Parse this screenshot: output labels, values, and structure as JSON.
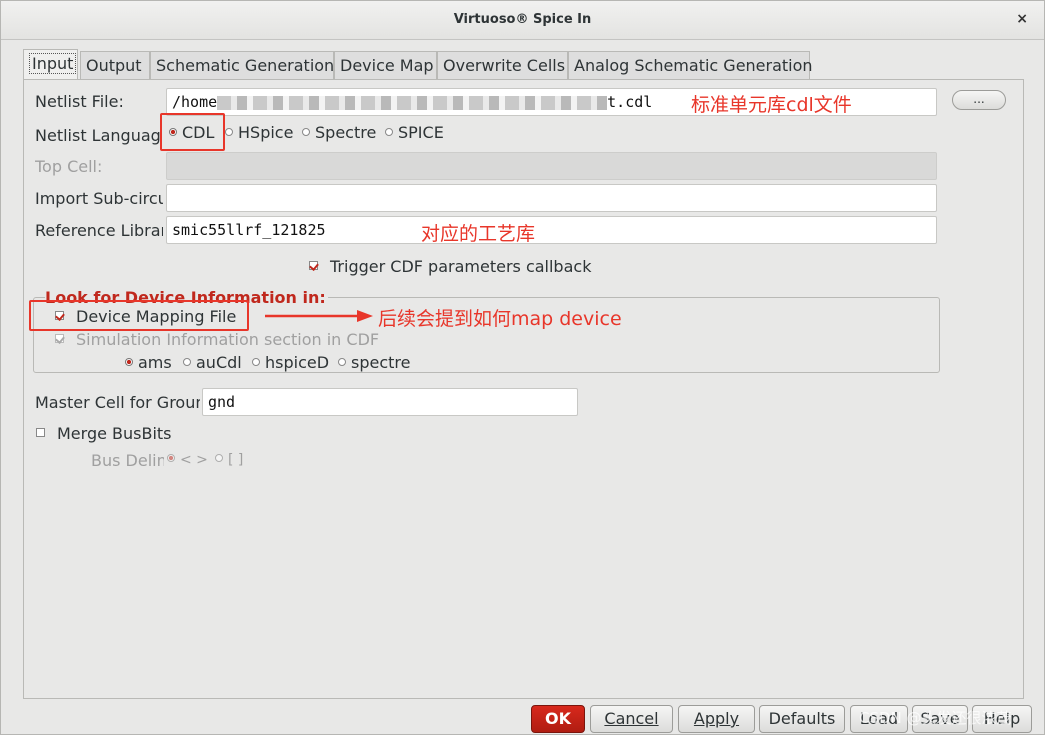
{
  "window": {
    "title": "Virtuoso® Spice In",
    "close_glyph": "×"
  },
  "tabs": [
    {
      "label": "Input",
      "active": true
    },
    {
      "label": "Output"
    },
    {
      "label": "Schematic Generation"
    },
    {
      "label": "Device Map"
    },
    {
      "label": "Overwrite Cells"
    },
    {
      "label": "Analog Schematic Generation"
    }
  ],
  "form": {
    "netlist_file_label": "Netlist File:",
    "netlist_file_prefix": "/home",
    "netlist_file_suffix": "t.cdl",
    "browse_label": "...",
    "netlist_language_label": "Netlist Language",
    "languages": [
      {
        "label": "CDL",
        "selected": true
      },
      {
        "label": "HSpice"
      },
      {
        "label": "Spectre"
      },
      {
        "label": "SPICE"
      }
    ],
    "top_cell_label": "Top Cell:",
    "top_cell_value": "",
    "import_sub_label": "Import Sub-circu",
    "import_sub_value": "",
    "reference_library_label": "Reference Librar",
    "reference_library_value": "smic55llrf_121825",
    "trigger_cdf_label": "Trigger CDF parameters callback",
    "trigger_cdf_checked": true,
    "device_group_title": "Look for Device Information in:",
    "device_mapping_label": "Device Mapping File",
    "device_mapping_checked": true,
    "simulation_info_label": "Simulation Information section in CDF",
    "simulation_info_checked": true,
    "simulators": [
      {
        "label": "ams",
        "selected": true
      },
      {
        "label": "auCdl"
      },
      {
        "label": "hspiceD"
      },
      {
        "label": "spectre"
      }
    ],
    "master_cell_label": "Master Cell for Groun",
    "master_cell_value": "gnd",
    "merge_busbits_label": "Merge BusBits",
    "merge_busbits_checked": false,
    "bus_delim_label": "Bus Delim",
    "bus_delims": [
      {
        "label": "< >",
        "selected": true
      },
      {
        "label": "[ ]"
      }
    ]
  },
  "buttons": {
    "ok": "OK",
    "cancel": "Cancel",
    "apply": "Apply",
    "defaults": "Defaults",
    "load": "Load",
    "save": "Save",
    "help": "Help"
  },
  "annotations": {
    "netlist_note": "标准单元库cdl文件",
    "reference_note": "对应的工艺库",
    "device_note": "后续会提到如何map device"
  },
  "watermark": "CSDN @头发还很浓茂",
  "colors": {
    "annotation_red": "#e8362a",
    "ok_button": "#c0281d",
    "dialog_background": "#e8e8e7"
  }
}
